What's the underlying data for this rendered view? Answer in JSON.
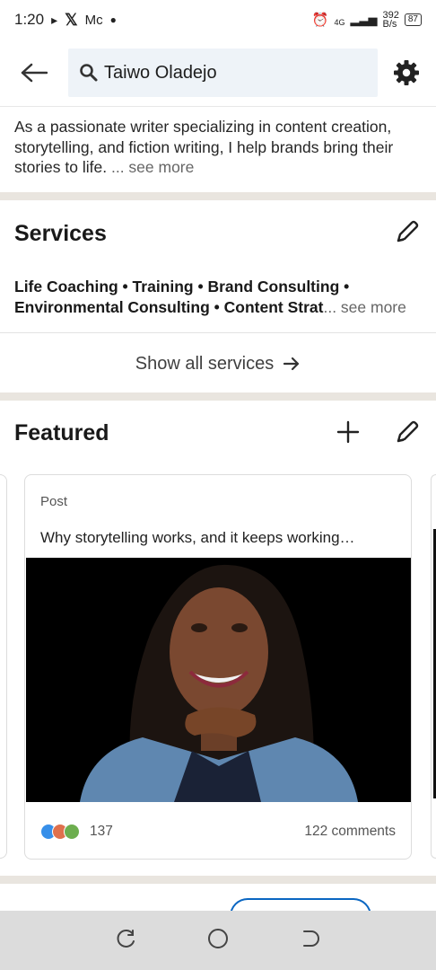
{
  "status_bar": {
    "time": "1:20",
    "notif_text": "Mc",
    "net_type": "4G",
    "speed_value": "392",
    "speed_unit": "B/s",
    "battery": "87"
  },
  "top_bar": {
    "search_query": "Taiwo Oladejo"
  },
  "about": {
    "text": "As a passionate writer specializing in content creation, storytelling, and fiction writing, I help brands bring their stories to life. ",
    "see_more": "... see more"
  },
  "services": {
    "title": "Services",
    "list": "Life Coaching • Training • Brand Consulting • Environmental Consulting • Content Strat",
    "see_more": "... see more",
    "show_all": "Show all services"
  },
  "featured": {
    "title": "Featured",
    "card": {
      "kind": "Post",
      "description": "Why storytelling works, and it keeps working…",
      "reaction_count": "137",
      "comments": "122 comments"
    }
  },
  "colors": {
    "accent": "#0a66c2",
    "search_bg": "#eef3f8",
    "section_gap": "#e9e5df"
  }
}
